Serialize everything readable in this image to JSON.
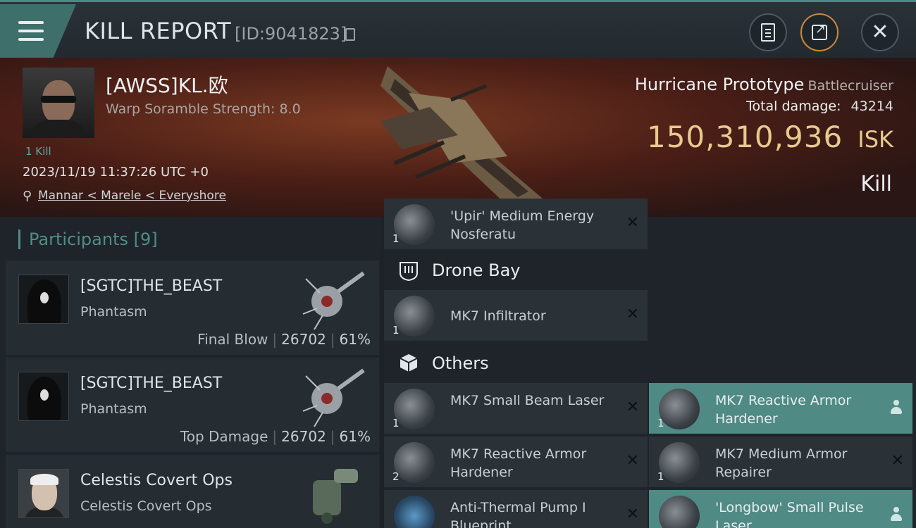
{
  "header": {
    "title": "KILL REPORT",
    "id": "[ID:9041823]"
  },
  "victim": {
    "name": "[AWSS]KL.欧",
    "warp_scramble": "Warp Soramble Strength: 8.0",
    "kill_count": "1 Kill",
    "timestamp": "2023/11/19 11:37:26 UTC +0",
    "location": "Mannar < Marele < Everyshore"
  },
  "ship": {
    "name": "Hurricane Prototype",
    "class": "Battlecruiser",
    "total_damage_label": "Total damage:",
    "total_damage": "43214",
    "isk_value": "150,310,936",
    "isk_unit": "ISK",
    "result": "Kill"
  },
  "participants": {
    "title": "Participants",
    "count": "[9]",
    "items": [
      {
        "name": "[SGTC]THE_BEAST",
        "ship": "Phantasm",
        "label": "Final Blow",
        "damage": "26702",
        "pct": "61%"
      },
      {
        "name": "[SGTC]THE_BEAST",
        "ship": "Phantasm",
        "label": "Top Damage",
        "damage": "26702",
        "pct": "61%"
      },
      {
        "name": "Celestis Covert Ops",
        "ship": "Celestis Covert Ops",
        "label": "",
        "damage": "",
        "pct": ""
      }
    ]
  },
  "fitting": {
    "top_item": {
      "qty": "1",
      "name": "'Upir' Medium Energy Nosferatu"
    },
    "drone_bay_title": "Drone Bay",
    "drone_item": {
      "qty": "1",
      "name": "MK7  Infiltrator"
    },
    "others_title": "Others",
    "others": [
      {
        "qty": "1",
        "name": "MK7 Small Beam Laser",
        "dropped": false
      },
      {
        "qty": "1",
        "name": "MK7 Reactive Armor Hardener",
        "dropped": true
      },
      {
        "qty": "2",
        "name": "MK7 Reactive Armor Hardener",
        "dropped": false
      },
      {
        "qty": "1",
        "name": "MK7 Medium Armor Repairer",
        "dropped": false
      },
      {
        "qty": "",
        "name": "Anti-Thermal Pump I Blueprint",
        "dropped": false
      },
      {
        "qty": "",
        "name": "'Longbow' Small Pulse Laser",
        "dropped": true
      }
    ],
    "remove_glyph": "✕"
  },
  "colors": {
    "accent_teal": "#4f8a84",
    "isk_gold": "#e8c98e",
    "banner_red": "#7a3a22"
  }
}
